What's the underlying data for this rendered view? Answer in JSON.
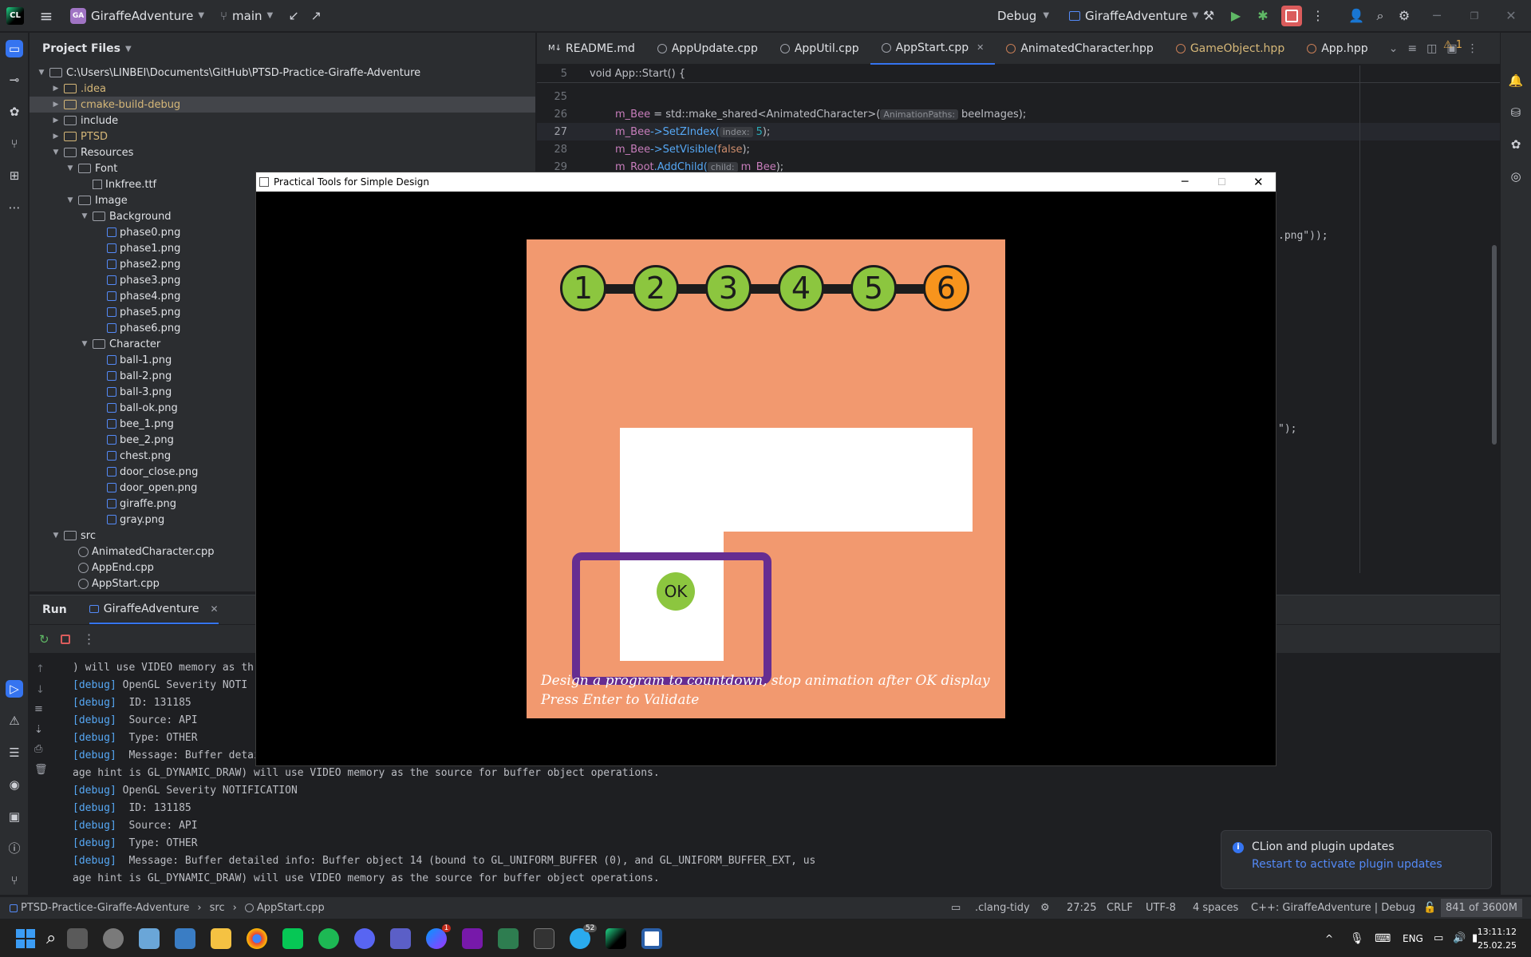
{
  "titlebar": {
    "project_badge": "GA",
    "project_name": "GiraffeAdventure",
    "branch": "main",
    "config": "Debug",
    "run_target": "GiraffeAdventure"
  },
  "project_panel": {
    "title": "Project Files",
    "tree": [
      {
        "label": "C:\\Users\\LINBEI\\Documents\\GitHub\\PTSD-Practice-Giraffe-Adventure",
        "kind": "folder",
        "depth": 0,
        "expanded": true
      },
      {
        "label": ".idea",
        "kind": "folder",
        "depth": 1,
        "expanded": false,
        "color": "yellow"
      },
      {
        "label": "cmake-build-debug",
        "kind": "folder",
        "depth": 1,
        "expanded": false,
        "color": "yellow",
        "selected": true
      },
      {
        "label": "include",
        "kind": "folder",
        "depth": 1,
        "expanded": false
      },
      {
        "label": "PTSD",
        "kind": "folder",
        "depth": 1,
        "expanded": false,
        "color": "yellow"
      },
      {
        "label": "Resources",
        "kind": "folder",
        "depth": 1,
        "expanded": true
      },
      {
        "label": "Font",
        "kind": "folder",
        "depth": 2,
        "expanded": true
      },
      {
        "label": "Inkfree.ttf",
        "kind": "ttf",
        "depth": 3
      },
      {
        "label": "Image",
        "kind": "folder",
        "depth": 2,
        "expanded": true
      },
      {
        "label": "Background",
        "kind": "folder",
        "depth": 3,
        "expanded": true
      },
      {
        "label": "phase0.png",
        "kind": "img",
        "depth": 4
      },
      {
        "label": "phase1.png",
        "kind": "img",
        "depth": 4
      },
      {
        "label": "phase2.png",
        "kind": "img",
        "depth": 4
      },
      {
        "label": "phase3.png",
        "kind": "img",
        "depth": 4
      },
      {
        "label": "phase4.png",
        "kind": "img",
        "depth": 4
      },
      {
        "label": "phase5.png",
        "kind": "img",
        "depth": 4
      },
      {
        "label": "phase6.png",
        "kind": "img",
        "depth": 4
      },
      {
        "label": "Character",
        "kind": "folder",
        "depth": 3,
        "expanded": true
      },
      {
        "label": "ball-1.png",
        "kind": "img",
        "depth": 4
      },
      {
        "label": "ball-2.png",
        "kind": "img",
        "depth": 4
      },
      {
        "label": "ball-3.png",
        "kind": "img",
        "depth": 4
      },
      {
        "label": "ball-ok.png",
        "kind": "img",
        "depth": 4
      },
      {
        "label": "bee_1.png",
        "kind": "img",
        "depth": 4
      },
      {
        "label": "bee_2.png",
        "kind": "img",
        "depth": 4
      },
      {
        "label": "chest.png",
        "kind": "img",
        "depth": 4
      },
      {
        "label": "door_close.png",
        "kind": "img",
        "depth": 4
      },
      {
        "label": "door_open.png",
        "kind": "img",
        "depth": 4
      },
      {
        "label": "giraffe.png",
        "kind": "img",
        "depth": 4
      },
      {
        "label": "gray.png",
        "kind": "img",
        "depth": 4
      },
      {
        "label": "src",
        "kind": "folder",
        "depth": 1,
        "expanded": true
      },
      {
        "label": "AnimatedCharacter.cpp",
        "kind": "cpp",
        "depth": 2
      },
      {
        "label": "AppEnd.cpp",
        "kind": "cpp",
        "depth": 2
      },
      {
        "label": "AppStart.cpp",
        "kind": "cpp",
        "depth": 2
      }
    ]
  },
  "editor": {
    "tabs": [
      {
        "label": "README.md",
        "kind": "md"
      },
      {
        "label": "AppUpdate.cpp",
        "kind": "cpp"
      },
      {
        "label": "AppUtil.cpp",
        "kind": "cpp"
      },
      {
        "label": "AppStart.cpp",
        "kind": "cpp",
        "active": true
      },
      {
        "label": "AnimatedCharacter.hpp",
        "kind": "hpp"
      },
      {
        "label": "GameObject.hpp",
        "kind": "hpp",
        "color": "yellow"
      },
      {
        "label": "App.hpp",
        "kind": "hpp"
      }
    ],
    "warning_count": "1",
    "sticky_line": {
      "num": "5",
      "code": "void App::Start() {"
    },
    "lines": [
      {
        "num": "25"
      },
      {
        "num": "26"
      },
      {
        "num": "27"
      },
      {
        "num": "28"
      },
      {
        "num": "29"
      }
    ],
    "line26_a": "m_Bee",
    "line26_b": " = std::make_shared<AnimatedCharacter>(",
    "line26_hint": "AnimationPaths:",
    "line26_c": "beeImages);",
    "line27_a": "m_Bee",
    "line27_b": "->SetZIndex(",
    "line27_hint": "index:",
    "line27_c": "5",
    "line27_d": ");",
    "line28_a": "m_Bee",
    "line28_b": "->SetVisible(",
    "line28_c": "false",
    "line28_d": ");",
    "line29_a": "m_Root",
    "line29_b": ".AddChild(",
    "line29_hint": "child:",
    "line29_c": "m_Bee",
    "line29_d": ");",
    "fragment_1": ".png\"));",
    "fragment_2": "\");"
  },
  "run_panel": {
    "tab_run": "Run",
    "tab_config": "GiraffeAdventure",
    "log": [
      {
        "text": ") will use VIDEO memory as th",
        "debug": false
      },
      {
        "tag": "[debug]",
        "text": " OpenGL Severity NOTI",
        "debug": true
      },
      {
        "tag": "[debug]",
        "text": "  ID: 131185",
        "debug": true
      },
      {
        "tag": "[debug]",
        "text": "  Source: API",
        "debug": true
      },
      {
        "tag": "[debug]",
        "text": "  Type: OTHER",
        "debug": true
      },
      {
        "tag": "[debug]",
        "text": "  Message: Buffer detai",
        "debug": true
      },
      {
        "text": "age hint is GL_DYNAMIC_DRAW) will use VIDEO memory as the source for buffer object operations.",
        "debug": false
      },
      {
        "tag": "[debug]",
        "text": " OpenGL Severity NOTIFICATION",
        "debug": true
      },
      {
        "tag": "[debug]",
        "text": "  ID: 131185",
        "debug": true
      },
      {
        "tag": "[debug]",
        "text": "  Source: API",
        "debug": true
      },
      {
        "tag": "[debug]",
        "text": "  Type: OTHER",
        "debug": true
      },
      {
        "tag": "[debug]",
        "text": "  Message: Buffer detailed info: Buffer object 14 (bound to GL_UNIFORM_BUFFER (0), and GL_UNIFORM_BUFFER_EXT, us",
        "debug": true
      },
      {
        "text": "age hint is GL_DYNAMIC_DRAW) will use VIDEO memory as the source for buffer object operations.",
        "debug": false
      }
    ]
  },
  "notification": {
    "title": "CLion and plugin updates",
    "link": "Restart to activate plugin updates"
  },
  "statusbar": {
    "breadcrumb": [
      "PTSD-Practice-Giraffe-Adventure",
      "src",
      "AppStart.cpp"
    ],
    "clang_tidy": ".clang-tidy",
    "position": "27:25",
    "line_sep": "CRLF",
    "encoding": "UTF-8",
    "indent": "4 spaces",
    "context": "C++: GiraffeAdventure | Debug",
    "memory": "841 of 3600M"
  },
  "game_window": {
    "title": "Practical Tools for Simple Design",
    "phases": [
      {
        "label": "1",
        "state": "done"
      },
      {
        "label": "2",
        "state": "done"
      },
      {
        "label": "3",
        "state": "done"
      },
      {
        "label": "4",
        "state": "done"
      },
      {
        "label": "5",
        "state": "done"
      },
      {
        "label": "6",
        "state": "current"
      }
    ],
    "ok_label": "OK",
    "instruction_1": "Design a program to countdown, stop animation after OK display",
    "instruction_2": "Press Enter to Validate",
    "colors": {
      "background": "#f2996f",
      "done": "#8cc63f",
      "current": "#f7941d",
      "frame": "#662d91"
    }
  },
  "taskbar": {
    "language": "ENG",
    "time": "13:11:12",
    "date": "25.02.25",
    "messenger_badge": "1",
    "telegram_badge": "52"
  }
}
